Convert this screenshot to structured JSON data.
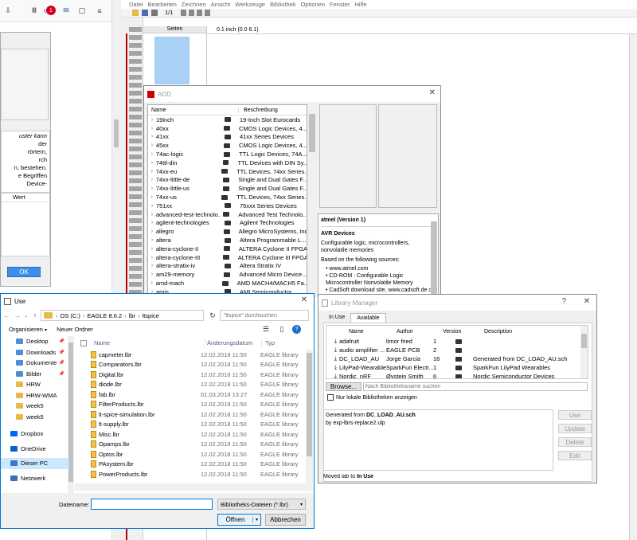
{
  "browser": {
    "icons": [
      "library-icon",
      "reader-icon",
      "badge-icon",
      "mail-icon",
      "zoom-icon",
      "menu-icon"
    ],
    "badge_count": "1"
  },
  "left_panel": {
    "text_lines": [
      "uster kann",
      "der",
      "rörtern,",
      "rch",
      "n, bestehen.",
      "e Begriffen",
      "Device-"
    ],
    "column_header": "Wert",
    "ok_label": "OK"
  },
  "eagle": {
    "menu": [
      "Datei",
      "Bearbeiten",
      "Zeichnen",
      "Ansicht",
      "Werkzeuge",
      "Bibliothek",
      "Optionen",
      "Fenster",
      "Hilfe"
    ],
    "page_selector": "1/1",
    "pages_label": "Seiten",
    "coord_readout": "0.1 inch (0.0 6.1)"
  },
  "add_dialog": {
    "title": "ADD",
    "col_name": "Name",
    "col_desc": "Beschreibung",
    "rows": [
      {
        "name": "19inch",
        "desc": "19-Inch Slot Eurocards"
      },
      {
        "name": "40xx",
        "desc": "CMOS Logic Devices, 4..."
      },
      {
        "name": "41xx",
        "desc": "41xx Series Devices"
      },
      {
        "name": "45xx",
        "desc": "CMOS Logic Devices, 4..."
      },
      {
        "name": "74ac-logic",
        "desc": "TTL Logic Devices, 74A..."
      },
      {
        "name": "74ttl-din",
        "desc": "TTL Devices with DIN Sy..."
      },
      {
        "name": "74xx-eu",
        "desc": "TTL Devices, 74xx Series..."
      },
      {
        "name": "74xx-little-de",
        "desc": "Single and Dual Gates F..."
      },
      {
        "name": "74xx-little-us",
        "desc": "Single and Dual Gates F..."
      },
      {
        "name": "74xx-us",
        "desc": "TTL Devices, 74xx Series..."
      },
      {
        "name": "751xx",
        "desc": "75xxx Series Devices"
      },
      {
        "name": "advanced-test-technolo...",
        "desc": "Advanced Test Technolo..."
      },
      {
        "name": "agilent-technologies",
        "desc": "Agilent Technologies"
      },
      {
        "name": "allegro",
        "desc": "Allegro MicroSystems, Inc"
      },
      {
        "name": "altera",
        "desc": "Altera Programmable L..."
      },
      {
        "name": "altera-cyclone-II",
        "desc": "ALTERA Cyclone II FPGA"
      },
      {
        "name": "altera-cyclone-III",
        "desc": "ALTERA Cyclone III FPGA"
      },
      {
        "name": "altera-stratix-iv",
        "desc": "Altera Stratix IV"
      },
      {
        "name": "am29-memory",
        "desc": "Advanced Micro Device..."
      },
      {
        "name": "amd-mach",
        "desc": "AMD MACH4/MACH5 Fa..."
      },
      {
        "name": "amis",
        "desc": "AMI Semiconductor"
      }
    ],
    "info": {
      "title": "atmel (Version 1)",
      "heading": "AVR Devices",
      "desc": "Configurable logic, microcontrollers, nonvolatile memories",
      "sources_label": "Based on the following sources:",
      "bullets": [
        "www.atmel.com",
        "CD-ROM : Configurable Logic Microcontroller Nonvolatile Memory",
        "CadSoft download site, www.cadsoft.de or www.cadsoftusa.com , file"
      ]
    }
  },
  "use_dialog": {
    "title": "Use",
    "breadcrumb": [
      "OS (C:)",
      "EAGLE 8.6.2",
      "lbr",
      "ltspice"
    ],
    "search_placeholder": "\"ltspice\" durchsuchen",
    "organize_label": "Organisieren",
    "new_folder_label": "Neuer Ordner",
    "nav": [
      {
        "label": "Desktop",
        "icon": "desktop-folder-icon"
      },
      {
        "label": "Downloads",
        "icon": "downloads-icon"
      },
      {
        "label": "Dokumente",
        "icon": "documents-icon"
      },
      {
        "label": "Bilder",
        "icon": "pictures-icon"
      },
      {
        "label": "HRW",
        "icon": "folder-icon"
      },
      {
        "label": "HRW-WMA",
        "icon": "folder-icon"
      },
      {
        "label": "week5",
        "icon": "folder-icon"
      },
      {
        "label": "week5",
        "icon": "folder-icon"
      },
      {
        "label": "Dropbox",
        "icon": "dropbox-icon"
      },
      {
        "label": "OneDrive",
        "icon": "onedrive-icon"
      },
      {
        "label": "Dieser PC",
        "icon": "computer-icon"
      },
      {
        "label": "Netzwerk",
        "icon": "network-icon"
      }
    ],
    "col_name": "Name",
    "col_date": "Änderungsdatum",
    "col_type": "Typ",
    "files": [
      {
        "name": "capmeter.lbr",
        "date": "12.02.2018 11:50",
        "type": "EAGLE library"
      },
      {
        "name": "Comparators.lbr",
        "date": "12.02.2018 11:50",
        "type": "EAGLE library"
      },
      {
        "name": "Digital.lbr",
        "date": "12.02.2018 11:50",
        "type": "EAGLE library"
      },
      {
        "name": "diode.lbr",
        "date": "12.02.2018 11:50",
        "type": "EAGLE library"
      },
      {
        "name": "fab.lbr",
        "date": "01.03.2018 13:27",
        "type": "EAGLE library"
      },
      {
        "name": "FilterProducts.lbr",
        "date": "12.02.2018 11:50",
        "type": "EAGLE library"
      },
      {
        "name": "lt-spice-simulation.lbr",
        "date": "12.02.2018 11:50",
        "type": "EAGLE library"
      },
      {
        "name": "lt-supply.lbr",
        "date": "12.02.2018 11:50",
        "type": "EAGLE library"
      },
      {
        "name": "Misc.lbr",
        "date": "12.02.2018 11:50",
        "type": "EAGLE library"
      },
      {
        "name": "Opamps.lbr",
        "date": "12.02.2018 11:50",
        "type": "EAGLE library"
      },
      {
        "name": "Optos.lbr",
        "date": "12.02.2018 11:50",
        "type": "EAGLE library"
      },
      {
        "name": "PAsystem.lbr",
        "date": "12.02.2018 11:50",
        "type": "EAGLE library"
      },
      {
        "name": "PowerProducts.lbr",
        "date": "12.02.2018 11:50",
        "type": "EAGLE library"
      }
    ],
    "filename_label": "Dateiname:",
    "filename_value": "",
    "filetype": "Bibliotheks-Dateien (*.lbr)",
    "open_label": "Öffnen",
    "cancel_label": "Abbrechen"
  },
  "lib_manager": {
    "title": "Library Manager",
    "help_glyph": "?",
    "tabs": [
      "In Use",
      "Available"
    ],
    "col_name": "Name",
    "col_author": "Author",
    "col_version": "Version",
    "col_desc": "Description",
    "rows": [
      {
        "name": "adafruit",
        "author": "limor fried",
        "version": "1",
        "desc": ""
      },
      {
        "name": "audio amplifier ...",
        "author": "EAGLE PCB",
        "version": "2",
        "desc": ""
      },
      {
        "name": "DC_LOAD_AU",
        "author": "Jorge Garcia",
        "version": "16",
        "desc": "Generated from DC_LOAD_AU.sch"
      },
      {
        "name": "LilyPad-Wearables",
        "author": "SparkFun Electr...",
        "version": "1",
        "desc": "SparkFun LilyPad Wearables"
      },
      {
        "name": "Nordic_nRF",
        "author": "Øystein Smith",
        "version": "6",
        "desc": "Nordic Semiconductor Devices"
      }
    ],
    "browse_label": "Browse...",
    "search_placeholder": "Nach Bibliotheksname suchen",
    "local_only_label": "Nur lokale Bibliotheken anzeigen",
    "detail_prefix": "Generated from ",
    "detail_bold": "DC_LOAD_AU.sch",
    "detail_line2": "by exp-lbrs-replace2.ulp",
    "buttons": [
      "Use",
      "Update",
      "Delete",
      "Edit"
    ],
    "status_prefix": "Moved ",
    "status_italic": "lab",
    "status_mid": " to ",
    "status_bold": "In Use"
  }
}
